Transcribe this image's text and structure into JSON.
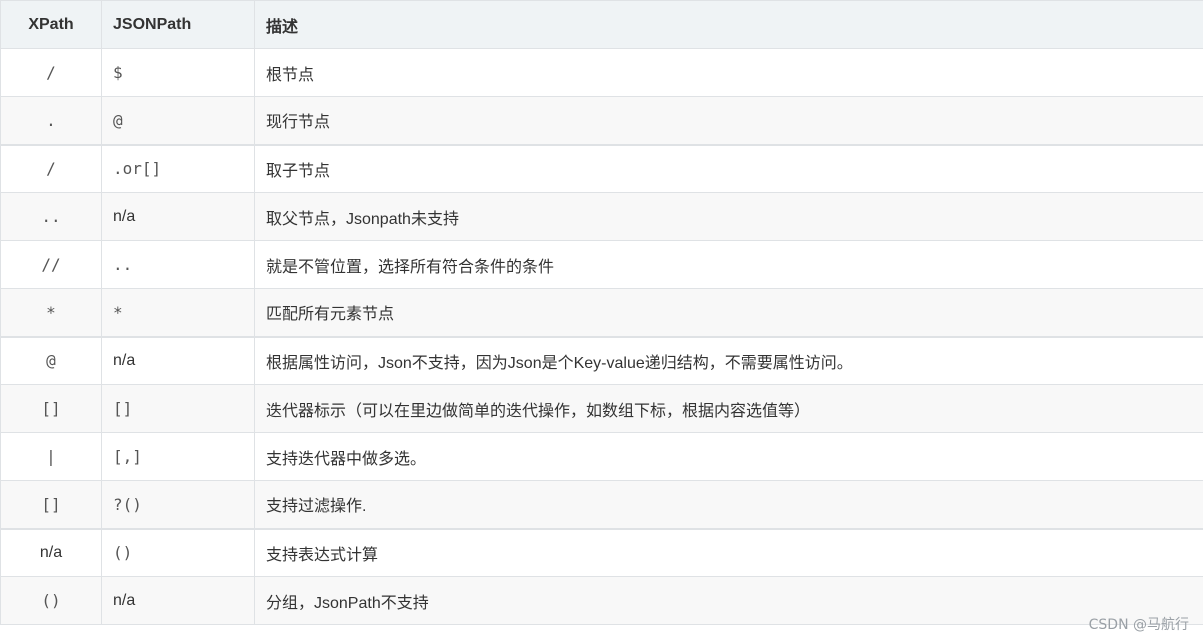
{
  "table": {
    "headers": [
      "XPath",
      "JSONPath",
      "描述"
    ],
    "rows": [
      {
        "xpath": "/",
        "jsonpath": "$",
        "desc": "根节点"
      },
      {
        "xpath": ".",
        "jsonpath": "@",
        "desc": "现行节点"
      },
      {
        "xpath": "/",
        "jsonpath": ".or[]",
        "desc": "取子节点"
      },
      {
        "xpath": "..",
        "jsonpath": "n/a",
        "desc": "取父节点，Jsonpath未支持"
      },
      {
        "xpath": "//",
        "jsonpath": "..",
        "desc": "就是不管位置，选择所有符合条件的条件"
      },
      {
        "xpath": "*",
        "jsonpath": "*",
        "desc": "匹配所有元素节点"
      },
      {
        "xpath": "@",
        "jsonpath": "n/a",
        "desc": "根据属性访问，Json不支持，因为Json是个Key-value递归结构，不需要属性访问。"
      },
      {
        "xpath": "[]",
        "jsonpath": "[]",
        "desc": "迭代器标示（可以在里边做简单的迭代操作，如数组下标，根据内容选值等）"
      },
      {
        "xpath": "|",
        "jsonpath": "[,]",
        "desc": "支持迭代器中做多选。"
      },
      {
        "xpath": "[]",
        "jsonpath": "?()",
        "desc": "支持过滤操作."
      },
      {
        "xpath": "n/a",
        "jsonpath": "()",
        "desc": "支持表达式计算"
      },
      {
        "xpath": "()",
        "jsonpath": "n/a",
        "desc": "分组，JsonPath不支持"
      }
    ]
  },
  "watermark": "CSDN @马航行"
}
